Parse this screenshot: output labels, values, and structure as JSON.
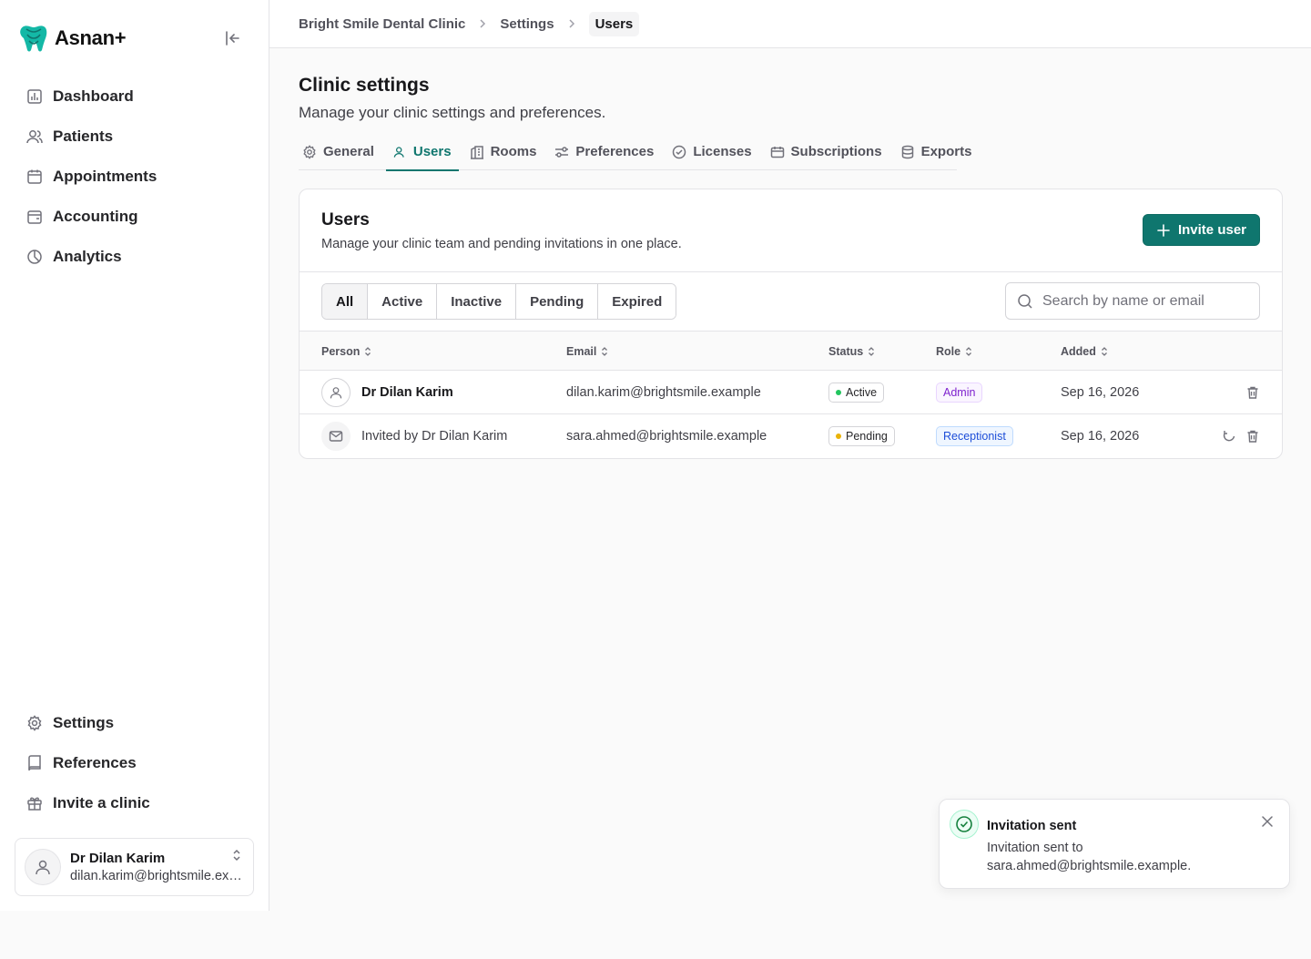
{
  "app": {
    "name": "Asnan+",
    "logo_icon": "tooth-logo-icon",
    "brand_color": "#0f766e"
  },
  "sidebar": {
    "collapse_icon": "collapse-sidebar-icon",
    "nav": [
      {
        "label": "Dashboard",
        "icon": "dashboard-icon"
      },
      {
        "label": "Patients",
        "icon": "users-icon"
      },
      {
        "label": "Appointments",
        "icon": "calendar-icon"
      },
      {
        "label": "Accounting",
        "icon": "wallet-icon"
      },
      {
        "label": "Analytics",
        "icon": "pie-chart-icon"
      }
    ],
    "bottom_nav": [
      {
        "label": "Settings",
        "icon": "gear-icon"
      },
      {
        "label": "References",
        "icon": "book-icon"
      },
      {
        "label": "Invite a clinic",
        "icon": "gift-icon"
      }
    ],
    "user": {
      "name": "Dr Dilan Karim",
      "email": "dilan.karim@brightsmile.example"
    }
  },
  "breadcrumb": [
    "Bright Smile Dental Clinic",
    "Settings",
    "Users"
  ],
  "page": {
    "title": "Clinic settings",
    "subtitle": "Manage your clinic settings and preferences.",
    "tabs": [
      {
        "label": "General",
        "icon": "gear-icon"
      },
      {
        "label": "Users",
        "icon": "users-icon",
        "active": true
      },
      {
        "label": "Rooms",
        "icon": "building-icon"
      },
      {
        "label": "Preferences",
        "icon": "sliders-icon"
      },
      {
        "label": "Licenses",
        "icon": "check-circle-icon"
      },
      {
        "label": "Subscriptions",
        "icon": "ticket-icon"
      },
      {
        "label": "Exports",
        "icon": "database-icon"
      }
    ]
  },
  "users_card": {
    "title": "Users",
    "description": "Manage your clinic team and pending invitations in one place.",
    "invite_button": "Invite user",
    "filters": [
      "All",
      "Active",
      "Inactive",
      "Pending",
      "Expired"
    ],
    "active_filter": "All",
    "search_placeholder": "Search by name or email",
    "columns": [
      "Person",
      "Email",
      "Status",
      "Role",
      "Added"
    ],
    "rows": [
      {
        "person": "Dr Dilan Karim",
        "email": "dilan.karim@brightsmile.example",
        "status": "Active",
        "status_color": "#22c55e",
        "role": "Admin",
        "added": "Sep 16, 2026"
      },
      {
        "person": "Invited by Dr Dilan Karim",
        "email": "sara.ahmed@brightsmile.example",
        "status": "Pending",
        "status_color": "#eab308",
        "role": "Receptionist",
        "added": "Sep 16, 2026"
      }
    ]
  },
  "toast": {
    "title": "Invitation sent",
    "body": "Invitation sent to sara.ahmed@brightsmile.example."
  }
}
